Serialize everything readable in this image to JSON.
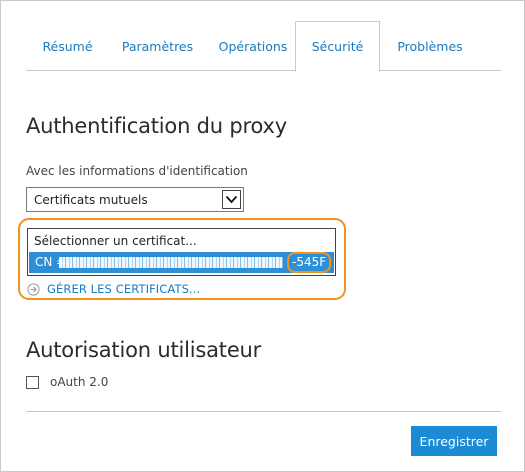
{
  "tabs": [
    {
      "label": "Résumé",
      "active": false
    },
    {
      "label": "Paramètres",
      "active": false
    },
    {
      "label": "Opérations",
      "active": false
    },
    {
      "label": "Sécurité",
      "active": true
    },
    {
      "label": "Problèmes",
      "active": false
    }
  ],
  "proxy_section": {
    "title": "Authentification du proxy",
    "credentials_label": "Avec les informations d'identification",
    "credentials_select": {
      "selected": "Certificats mutuels"
    },
    "certificate_list": {
      "placeholder": "Sélectionner un certificat...",
      "selected_prefix": "CN =",
      "selected_suffix": "-545F"
    },
    "manage_link": "GÉRER LES CERTIFICATS..."
  },
  "auth_section": {
    "title": "Autorisation utilisateur",
    "oauth_label": "oAuth 2.0",
    "oauth_checked": false
  },
  "save_button": "Enregistrer",
  "colors": {
    "accent": "#1a7bbf",
    "button": "#1a8bd4",
    "selection": "#2e8fd6",
    "highlight": "#f0931a",
    "border": "#c9c9c9"
  },
  "icons": {
    "select_arrow": "chevron-down-icon",
    "manage": "arrow-right-circle-icon"
  }
}
